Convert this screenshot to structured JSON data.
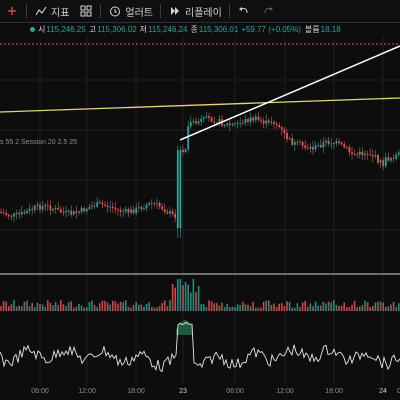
{
  "toolbar": {
    "indicators_label": "지표",
    "alert_label": "얼러트",
    "replay_label": "리플레이",
    "icons": [
      "add-icon",
      "indicators-icon",
      "layout-grid-icon",
      "alert-clock-icon",
      "replay-icon",
      "undo-icon",
      "redo-icon"
    ]
  },
  "legend": {
    "open_label": "시",
    "open_value": "115,246.25",
    "high_label": "고",
    "high_value": "115,306.02",
    "low_label": "저",
    "low_value": "115,246.24",
    "close_label": "종",
    "close_value": "115,306.01",
    "change_value": "+59.77 (+0.05%)",
    "volume_label": "볼륨",
    "volume_value": "18.18"
  },
  "study_label": "s 55 2 Session 20 2.5 25",
  "time_axis": [
    "06:00",
    "12:00",
    "18:00",
    "23",
    "06:00",
    "12:00",
    "18:00",
    "24",
    "0"
  ],
  "colors": {
    "up": "#26a69a",
    "down": "#ef5350",
    "trendline_yellow": "#e6d27a",
    "trendline_white": "#ffffff",
    "background": "#0d0d0d"
  }
}
